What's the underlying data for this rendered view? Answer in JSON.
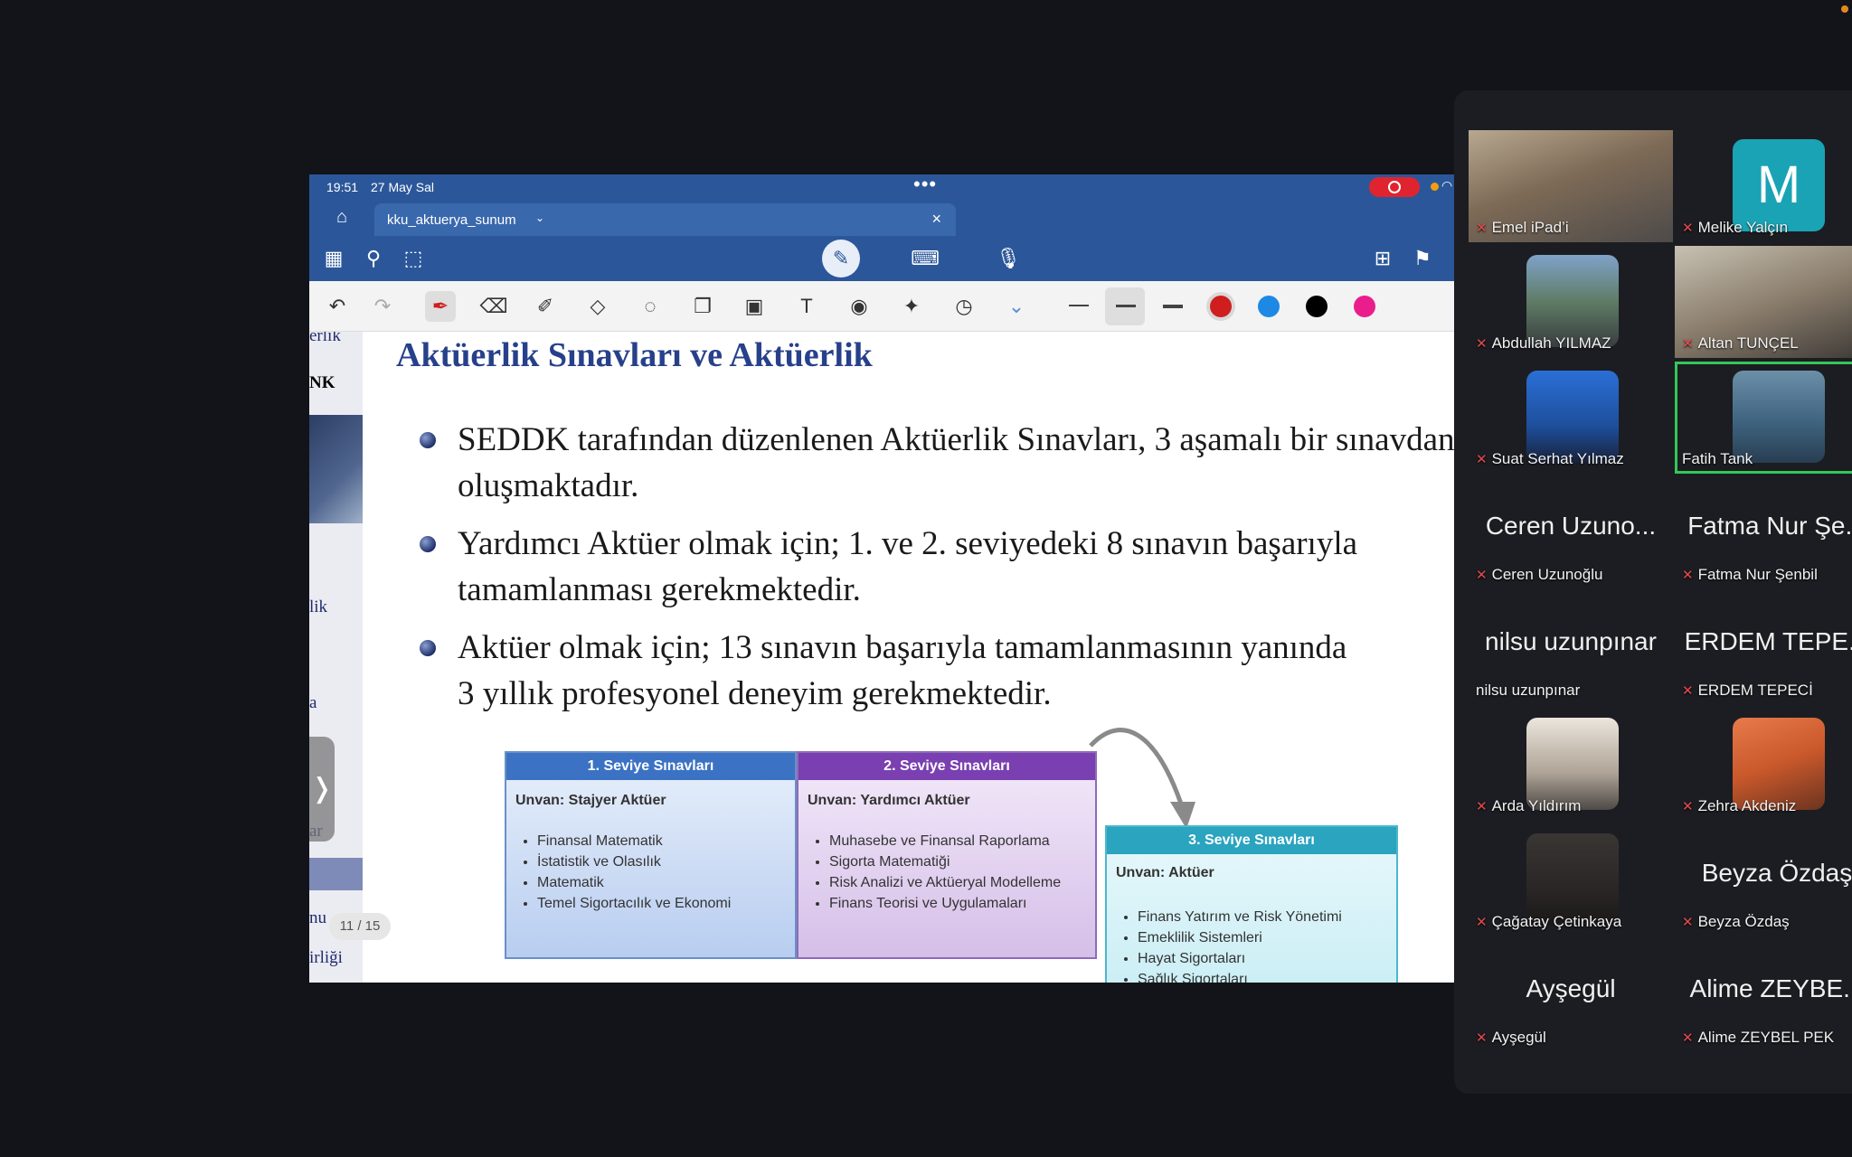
{
  "ipad_status": {
    "time": "19:51",
    "date": "27 May Sal",
    "dots": "•••"
  },
  "tab": {
    "name": "kku_aktuerya_sunum",
    "chevron": "⌄",
    "close": "×"
  },
  "toolbar_colors": {
    "red": "#d01e1e",
    "blue": "#1e88e5",
    "black": "#000000",
    "pink": "#e91e8c"
  },
  "thumbs": {
    "t1": "erlik",
    "t2": "NK",
    "t3": "lik",
    "t4": "a",
    "t5": "ar",
    "t6": "nu",
    "t7": "irliği"
  },
  "page_indicator": "11 / 15",
  "pager_chevron": "❭",
  "slide": {
    "title": "Aktüerlik Sınavları ve Aktüerlik",
    "bullets": [
      "SEDDK tarafından düzenlenen Aktüerlik Sınavları, 3 aşamalı bir sınavdan oluşmaktadır.",
      "Yardımcı Aktüer olmak için; 1. ve 2. seviyedeki 8 sınavın başarıyla tamamlanması gerekmektedir.",
      "Aktüer olmak için; 13 sınavın başarıyla tamamlanmasının yanında 3 yıllık profesyonel deneyim gerekmektedir."
    ],
    "levels": [
      {
        "header": "1. Seviye Sınavları",
        "title": "Unvan: Stajyer Aktüer",
        "items": [
          "Finansal Matematik",
          "İstatistik ve Olasılık",
          "Matematik",
          "Temel Sigortacılık ve Ekonomi"
        ]
      },
      {
        "header": "2. Seviye Sınavları",
        "title": "Unvan: Yardımcı Aktüer",
        "items": [
          "Muhasebe ve Finansal Raporlama",
          "Sigorta Matematiği",
          "Risk Analizi ve Aktüeryal Modelleme",
          "Finans Teorisi ve Uygulamaları"
        ]
      },
      {
        "header": "3. Seviye Sınavları",
        "title": "Unvan: Aktüer",
        "items": [
          "Finans Yatırım ve Risk Yönetimi",
          "Emeklilik Sistemleri",
          "Hayat Sigortaları",
          "Sağlık Sigortaları"
        ]
      }
    ]
  },
  "participants": [
    {
      "name": "Emel iPad’i",
      "muted": true,
      "display": "photo"
    },
    {
      "name": "Melike Yalçın",
      "muted": true,
      "display": "avatar",
      "initial": "M"
    },
    {
      "name": "Abdullah YILMAZ",
      "muted": true,
      "display": "photo"
    },
    {
      "name": "Altan TUNÇEL",
      "muted": true,
      "display": "photo"
    },
    {
      "name": "Suat Serhat Yılmaz",
      "muted": true,
      "display": "photo"
    },
    {
      "name": "Fatih Tank",
      "muted": false,
      "display": "photo",
      "active": true
    },
    {
      "name": "Ceren Uzunoğlu",
      "big": "Ceren Uzuno...",
      "muted": true,
      "display": "name"
    },
    {
      "name": "Fatma Nur Şenbil",
      "big": "Fatma Nur Şe...",
      "muted": true,
      "display": "name"
    },
    {
      "name": "nilsu uzunpınar",
      "big": "nilsu uzunpınar",
      "muted": false,
      "display": "name"
    },
    {
      "name": "ERDEM TEPECİ",
      "big": "ERDEM TEPE...",
      "muted": true,
      "display": "name"
    },
    {
      "name": "Arda Yıldırım",
      "muted": true,
      "display": "photo"
    },
    {
      "name": "Zehra Akdeniz",
      "muted": true,
      "display": "photo"
    },
    {
      "name": "Çağatay Çetinkaya",
      "muted": true,
      "display": "photo"
    },
    {
      "name": "Beyza Özdaş",
      "big": "Beyza Özdaş",
      "muted": true,
      "display": "name"
    },
    {
      "name": "Ayşegül",
      "big": "Ayşegül",
      "muted": true,
      "display": "name"
    },
    {
      "name": "Alime ZEYBEL PEK",
      "big": "Alime ZEYBE...",
      "muted": true,
      "display": "name"
    }
  ],
  "mic_icon": "✕"
}
